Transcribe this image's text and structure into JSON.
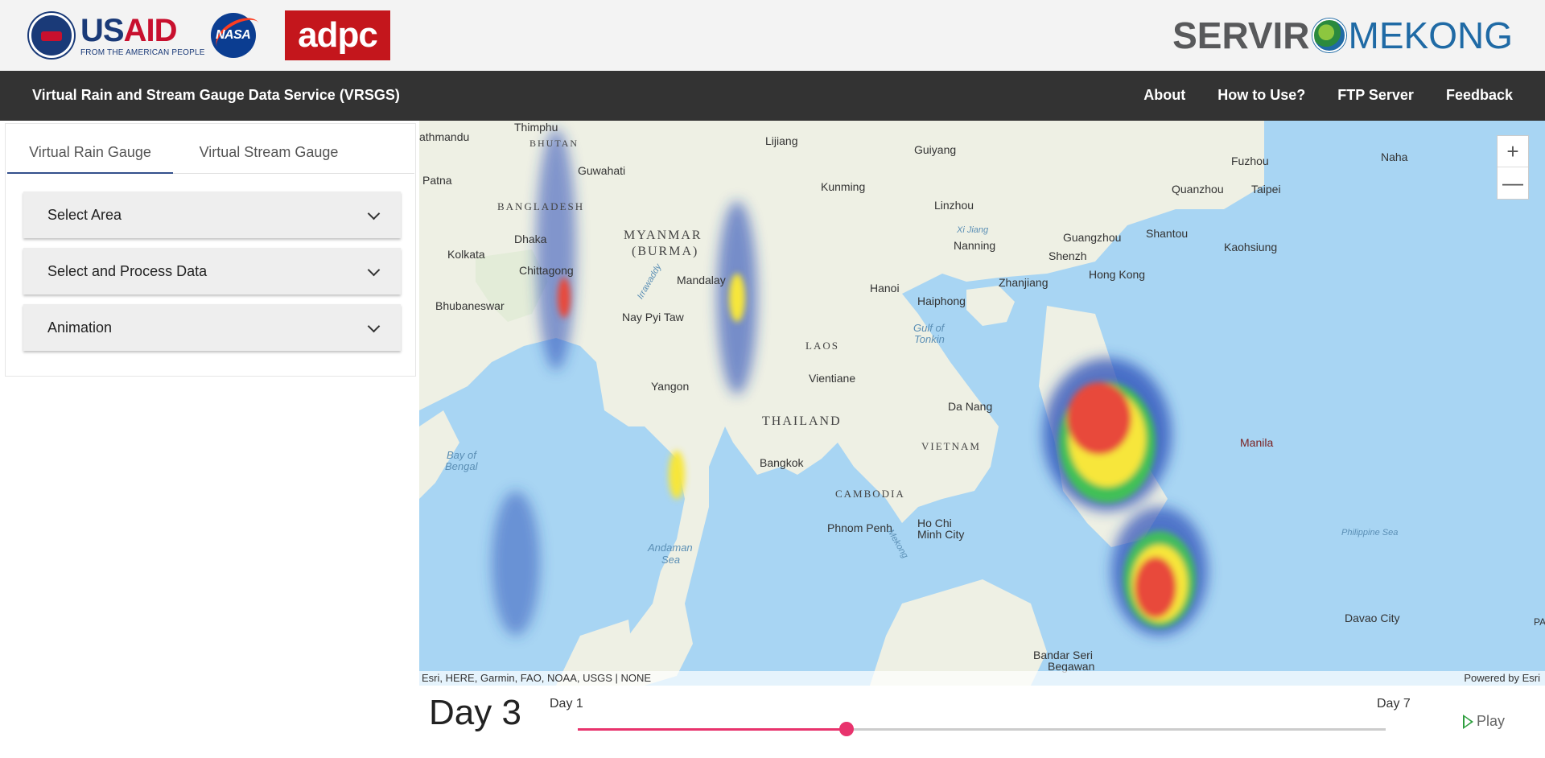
{
  "logos": {
    "usaid_us": "US",
    "usaid_aid": "AID",
    "usaid_sub": "FROM THE AMERICAN PEOPLE",
    "nasa": "NASA",
    "adpc": "adpc",
    "servir": "SERVIR",
    "mekong": "MEKONG"
  },
  "navbar": {
    "title": "Virtual Rain and Stream Gauge Data Service (VRSGS)",
    "links": [
      "About",
      "How to Use?",
      "FTP Server",
      "Feedback"
    ]
  },
  "sidebar": {
    "tabs": [
      {
        "label": "Virtual Rain Gauge",
        "active": true
      },
      {
        "label": "Virtual Stream Gauge",
        "active": false
      }
    ],
    "sections": [
      "Select Area",
      "Select and Process Data",
      "Animation"
    ]
  },
  "map": {
    "attribution_left": "Esri, HERE, Garmin, FAO, NOAA, USGS | NONE",
    "attribution_right": "Powered by Esri",
    "zoom_in": "+",
    "zoom_out": "—",
    "labels": {
      "thimphu": "Thimphu",
      "kathmandu": "athmandu",
      "bhutan": "BHUTAN",
      "guwahati": "Guwahati",
      "patna": "Patna",
      "bangladesh": "BANGLADESH",
      "dhaka": "Dhaka",
      "kolkata": "Kolkata",
      "chittagong": "Chittagong",
      "bhubaneswar": "Bhubaneswar",
      "myanmar": "MYANMAR",
      "burma": "(BURMA)",
      "mandalay": "Mandalay",
      "naypyitaw": "Nay Pyi Taw",
      "yangon": "Yangon",
      "lijiang": "Lijiang",
      "kunming": "Kunming",
      "guiyang": "Guiyang",
      "linzhou": "Linzhou",
      "nanning": "Nanning",
      "guangzhou": "Guangzhou",
      "shenzhen": "Shenzh",
      "hongkong": "Hong Kong",
      "zhanjiang": "Zhanjiang",
      "shantou": "Shantou",
      "fuzhou": "Fuzhou",
      "quanzhou": "Quanzhou",
      "taipei": "Taipei",
      "kaohsiung": "Kaohsiung",
      "naha": "Naha",
      "hanoi": "Hanoi",
      "haiphong": "Haiphong",
      "gulf_tonkin_1": "Gulf of",
      "gulf_tonkin_2": "Tonkin",
      "laos": "LAOS",
      "vientiane": "Vientiane",
      "thailand": "THAILAND",
      "bangkok": "Bangkok",
      "vietnam": "VIETNAM",
      "danang": "Da Nang",
      "cambodia": "CAMBODIA",
      "phnompenh": "Phnom Penh",
      "hochiminh1": "Ho Chi",
      "hochiminh2": "Minh City",
      "bay_bengal_1": "Bay of",
      "bay_bengal_2": "Bengal",
      "andaman1": "Andaman",
      "andaman2": "Sea",
      "manila": "Manila",
      "davao": "Davao City",
      "bandar1": "Bandar Seri",
      "bandar2": "Begawan",
      "mekong": "Mekong",
      "irrawaddy": "Irrawaddy",
      "xi_jiang": "Xi Jiang",
      "philippine_sea": "Philippine Sea",
      "pa": "PA"
    }
  },
  "timeline": {
    "current_day": "Day 3",
    "start_label": "Day 1",
    "end_label": "Day 7",
    "play_label": "Play",
    "slider_fraction": 0.333,
    "accent_color": "#e8336d"
  }
}
